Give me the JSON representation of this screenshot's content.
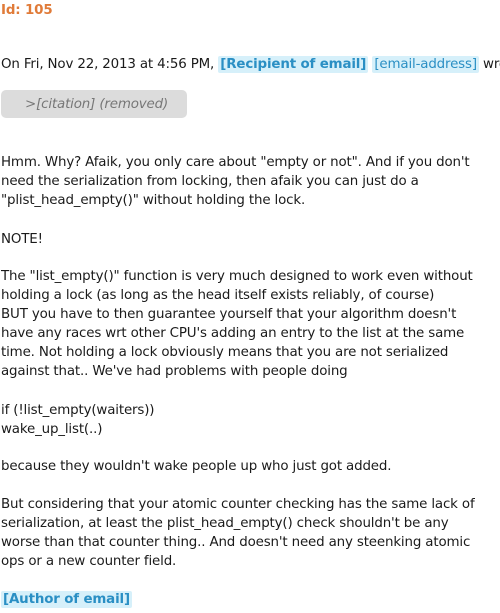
{
  "header": {
    "id_text": "Id: 105"
  },
  "intro": {
    "prefix": "On Fri, Nov 22, 2013 at 4:56 PM, ",
    "recipient_tag": "[Recipient of email]",
    "email_tag": "[email-address]",
    "suffix": " wrote:"
  },
  "citation": {
    "text": ">[citation] (removed)"
  },
  "body_lines": [
    "Hmm. Why? Afaik, you only care about \"empty or not\". And if you don't",
    "need the serialization from locking, then afaik you can just do a",
    "\"plist_head_empty()\" without holding the lock.",
    "NOTE!",
    "The \"list_empty()\" function is very much designed to work even without",
    "holding a lock (as long as the head itself exists reliably, of course)",
    "BUT you have to then guarantee yourself that your algorithm doesn't",
    "have any races wrt other CPU's adding an entry to the list at the same",
    "time. Not holding a lock obviously means that you are not serialized",
    "against that.. We've had problems with people doing",
    "if (!list_empty(waiters))",
    "wake_up_list(..)",
    "because they wouldn't wake people up who just got added.",
    "But considering that your atomic counter checking has the same lack of",
    "serialization, at least the plist_head_empty() check shouldn't be any",
    "worse than that counter thing.. And doesn't need any steenking atomic",
    "ops or a new counter field."
  ],
  "signature": {
    "author_tag": "[Author of email]"
  },
  "colors": {
    "id_orange": "#e07b39",
    "tag_background": "#d6f0fa",
    "tag_text": "#2a8fc4",
    "citation_background": "#dcdcdc"
  }
}
